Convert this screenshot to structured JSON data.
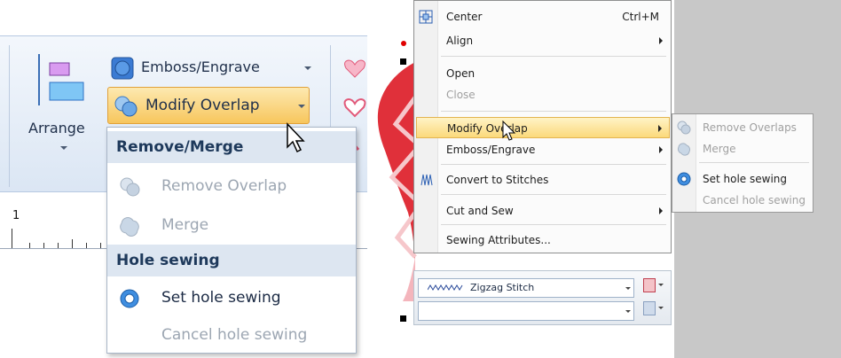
{
  "left": {
    "ribbon": {
      "arrange_label": "Arrange",
      "emboss_label": "Emboss/Engrave",
      "modify_overlap_label": "Modify Overlap"
    },
    "ruler": {
      "label": "1"
    },
    "dropdown": {
      "section1": "Remove/Merge",
      "remove_overlap": "Remove Overlap",
      "merge": "Merge",
      "section2": "Hole sewing",
      "set_hole_sewing": "Set hole sewing",
      "cancel_hole_sewing": "Cancel hole sewing"
    }
  },
  "right": {
    "menu": {
      "center": "Center",
      "center_shortcut": "Ctrl+M",
      "align": "Align",
      "open": "Open",
      "close": "Close",
      "modify_overlap": "Modify Overlap",
      "emboss_engrave": "Emboss/Engrave",
      "convert_to_stitches": "Convert to Stitches",
      "cut_and_sew": "Cut and Sew",
      "sewing_attributes": "Sewing Attributes..."
    },
    "submenu": {
      "remove_overlaps": "Remove Overlaps",
      "merge": "Merge",
      "set_hole_sewing": "Set hole sewing",
      "cancel_hole_sewing": "Cancel hole sewing"
    },
    "stitch_toolbar": {
      "stitch_type": "Zigzag Stitch",
      "stitch_type2": ""
    }
  },
  "colors": {
    "accent_highlight": "#f7c65d",
    "ribbon_bg": "#dbe6f4",
    "menu_highlight": "#fbd97b",
    "heart_red": "#e0303a"
  }
}
